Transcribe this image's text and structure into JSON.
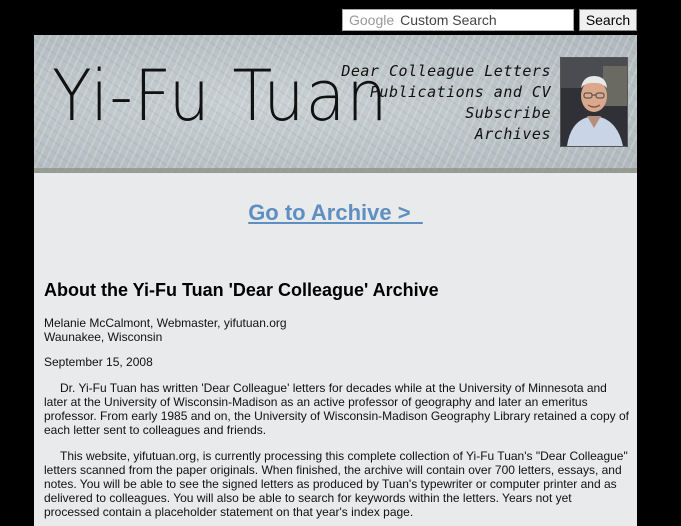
{
  "search": {
    "logo_text": "Google",
    "placeholder": "Custom Search",
    "button_label": "Search"
  },
  "header": {
    "site_title": "Yi-Fu Tuan",
    "nav": [
      {
        "label": "Dear Colleague Letters"
      },
      {
        "label": "Publications and CV"
      },
      {
        "label": "Subscribe"
      },
      {
        "label": "Archives"
      }
    ]
  },
  "main": {
    "archive_link": "Go to Archive >  ",
    "heading": "About the Yi-Fu Tuan 'Dear Colleague' Archive",
    "author_line1": "Melanie McCalmont, Webmaster, yifutuan.org",
    "author_line2": "Waunakee, Wisconsin",
    "date": "September 15, 2008",
    "paragraph1": "Dr. Yi-Fu Tuan has written 'Dear Colleague' letters for decades while at the University of Minnesota and later at the University of Wisconsin-Madison as an active professor of geography and later an emeritus professor. From early 1985 and on, the University of Wisconsin-Madison Geography Library retained a copy of each letter sent to colleagues and friends.",
    "paragraph2": "This website, yifutuan.org, is currently processing this complete collection of Yi-Fu Tuan's \"Dear Colleague\" letters scanned from the paper originals. When finished, the archive will contain over 700 letters, essays, and notes. You will be able to see the signed letters as produced by Tuan's typewriter or computer printer and as delivered to colleagues. You will also be able to search for keywords within the letters. Years not yet processed contain a placeholder statement on that year's index page."
  }
}
